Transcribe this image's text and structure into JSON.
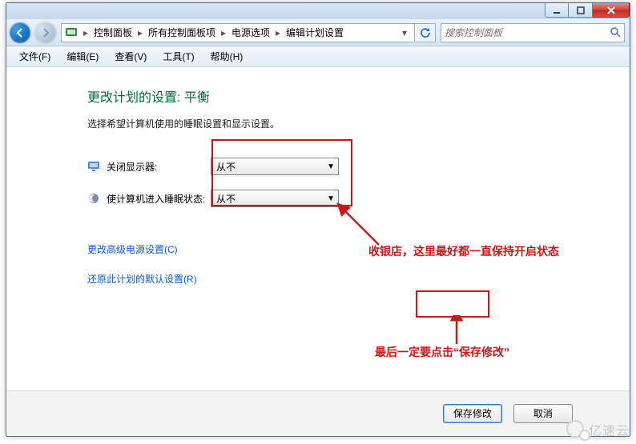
{
  "window": {
    "caption_min": "—",
    "caption_max": "□",
    "caption_close": "✕"
  },
  "breadcrumb": {
    "segments": [
      "控制面板",
      "所有控制面板项",
      "电源选项",
      "编辑计划设置"
    ]
  },
  "search": {
    "placeholder": "搜索控制面板"
  },
  "menu": {
    "file": "文件(F)",
    "edit": "编辑(E)",
    "view": "查看(V)",
    "tools": "工具(T)",
    "help": "帮助(H)"
  },
  "page": {
    "title": "更改计划的设置: 平衡",
    "desc": "选择希望计算机使用的睡眠设置和显示设置。"
  },
  "settings": {
    "display_off_label": "关闭显示器:",
    "display_off_value": "从不",
    "sleep_label": "使计算机进入睡眠状态:",
    "sleep_value": "从不"
  },
  "links": {
    "advanced": "更改高级电源设置(C)",
    "restore": "还原此计划的默认设置(R)"
  },
  "footer": {
    "save": "保存修改",
    "cancel": "取消"
  },
  "annotations": {
    "tip1": "收银店，这里最好都一直保持开启状态",
    "tip2": "最后一定要点击“保存修改”"
  },
  "watermark": "亿速云"
}
